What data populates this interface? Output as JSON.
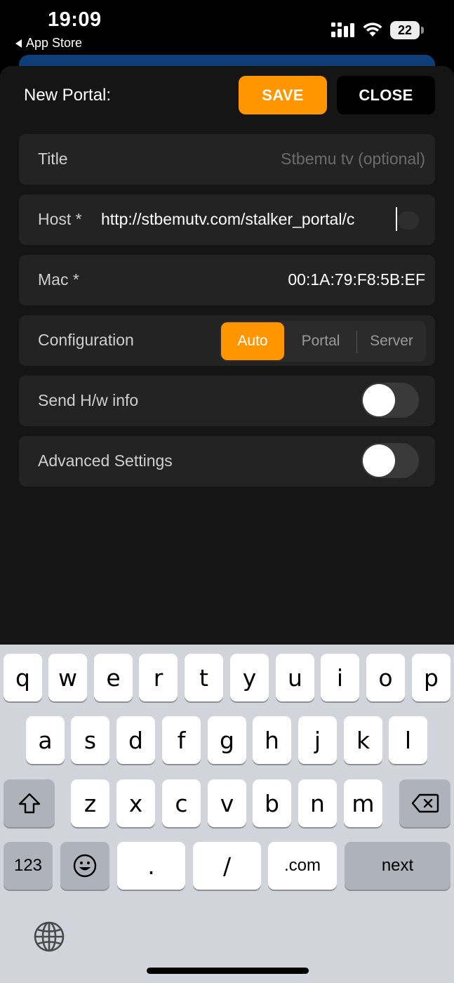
{
  "status_bar": {
    "time": "19:09",
    "back_label": "App Store",
    "battery": "22"
  },
  "header": {
    "title": "New Portal:",
    "save_label": "SAVE",
    "close_label": "CLOSE"
  },
  "colors": {
    "accent": "#ff9500",
    "sheet": "#151515",
    "row": "#232323",
    "blue_strip": "#0e3d77"
  },
  "form": {
    "title": {
      "label": "Title",
      "placeholder": "Stbemu tv (optional)"
    },
    "host": {
      "label": "Host *",
      "value": "http://stbemutv.com/stalker_portal/c"
    },
    "mac": {
      "label": "Mac *",
      "value": "00:1A:79:F8:5B:EF"
    },
    "configuration": {
      "label": "Configuration",
      "options": [
        "Auto",
        "Portal",
        "Server"
      ],
      "selected": "Auto"
    },
    "send_hw_info": {
      "label": "Send H/w info",
      "on": false
    },
    "advanced_settings": {
      "label": "Advanced Settings",
      "on": false
    }
  },
  "keyboard": {
    "row1": [
      "q",
      "w",
      "e",
      "r",
      "t",
      "y",
      "u",
      "i",
      "o",
      "p"
    ],
    "row2": [
      "a",
      "s",
      "d",
      "f",
      "g",
      "h",
      "j",
      "k",
      "l"
    ],
    "row3": [
      "z",
      "x",
      "c",
      "v",
      "b",
      "n",
      "m"
    ],
    "numbers_label": "123",
    "dot_label": ".",
    "slash_label": "/",
    "dotcom_label": ".com",
    "next_label": "next",
    "icons": [
      "shift-icon",
      "backspace-icon",
      "emoji-icon",
      "globe-icon"
    ]
  }
}
